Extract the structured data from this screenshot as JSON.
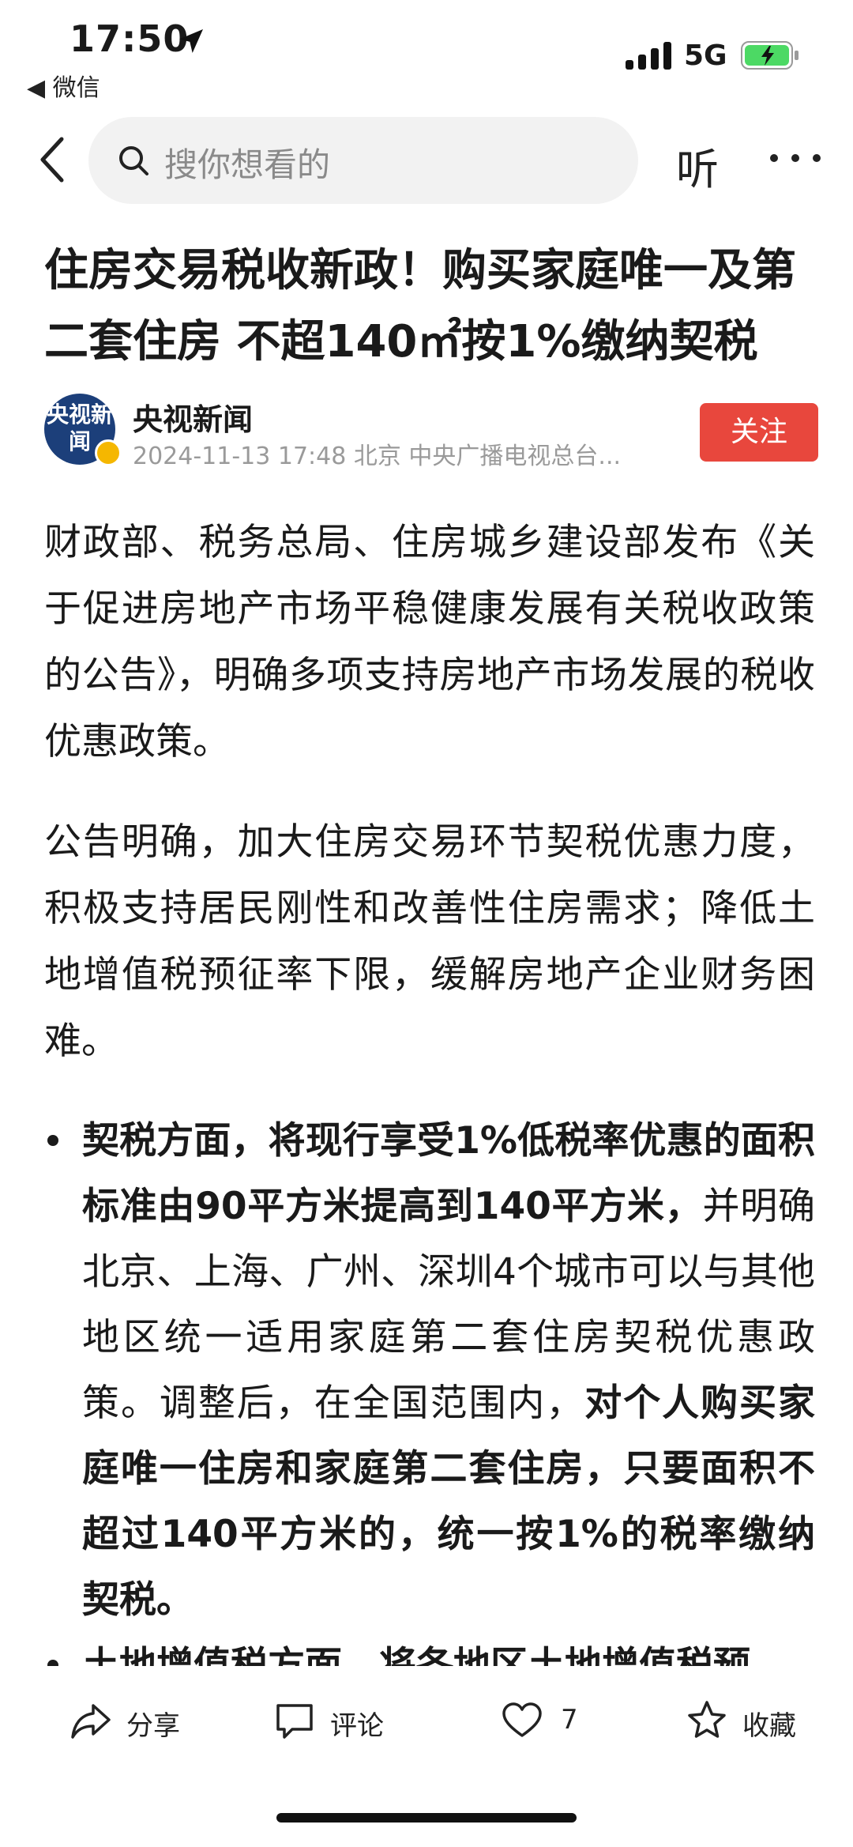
{
  "status_bar": {
    "time": "17:50",
    "back_app": "◀ 微信",
    "network": "5G"
  },
  "nav": {
    "search_placeholder": "搜你想看的",
    "listen_label": "听"
  },
  "article": {
    "title": "住房交易税收新政！购买家庭唯一及第二套住房 不超140㎡按1%缴纳契税",
    "author": {
      "avatar_text": "央视新闻",
      "name": "央视新闻",
      "meta": "2024-11-13  17:48  北京  中央广播电视总台..."
    },
    "follow_label": "关注",
    "paragraphs": [
      "财政部、税务总局、住房城乡建设部发布《关于促进房地产市场平稳健康发展有关税收政策的公告》，明确多项支持房地产市场发展的税收优惠政策。",
      "公告明确，加大住房交易环节契税优惠力度，积极支持居民刚性和改善性住房需求；降低土地增值税预征率下限，缓解房地产企业财务困难。"
    ],
    "bullets": [
      {
        "part1_bold": "契税方面，将现行享受1%低税率优惠的面积标准由90平方米提高到140平方米，",
        "part2": "并明确北京、上海、广州、深圳4个城市可以与其他地区统一适用家庭第二套住房契税优惠政策。调整后，在全国范围内，",
        "part3_bold": "对个人购买家庭唯一住房和家庭第二套住房，只要面积不超过140平方米的，统一按1%的税率缴纳契税。"
      },
      {
        "part1_bold": "土地增值税方面，将各地区土地增值税预"
      }
    ]
  },
  "toolbar": {
    "share_label": "分享",
    "comment_label": "评论",
    "like_count": "7",
    "favorite_label": "收藏"
  },
  "colors": {
    "accent": "#e8473d",
    "avatar_bg": "#1c3f7a",
    "verified": "#f5b700",
    "battery": "#4cd964"
  },
  "icons": [
    "location-arrow-icon",
    "signal-icon",
    "battery-icon",
    "back-arrow-icon",
    "search-icon",
    "more-icon",
    "share-icon",
    "comment-icon",
    "heart-icon",
    "star-icon"
  ]
}
